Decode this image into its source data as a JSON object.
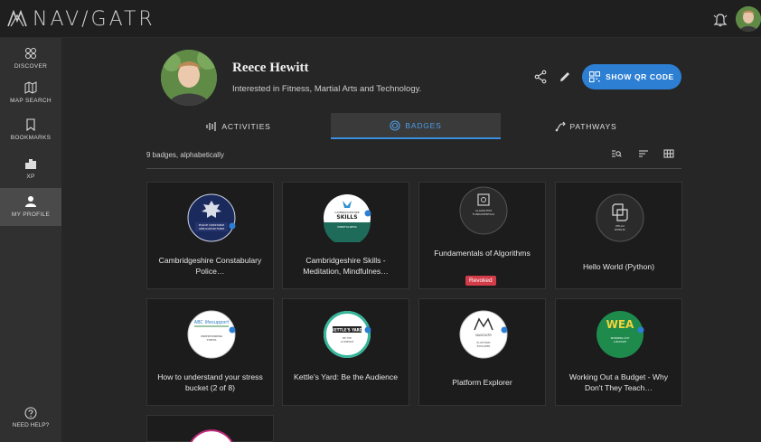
{
  "app": {
    "logo_text": "NAV/GATR"
  },
  "sidebar": {
    "items": [
      {
        "label": "DISCOVER",
        "icon": "discover-icon"
      },
      {
        "label": "MAP SEARCH",
        "icon": "map-icon"
      },
      {
        "label": "BOOKMARKS",
        "icon": "bookmark-icon"
      },
      {
        "label": "XP",
        "icon": "xp-icon"
      },
      {
        "label": "MY PROFILE",
        "icon": "person-icon",
        "active": true
      }
    ],
    "help_label": "NEED HELP?"
  },
  "profile": {
    "name": "Reece Hewitt",
    "bio": "Interested in Fitness, Martial Arts and Technology.",
    "qr_button_label": "SHOW QR CODE"
  },
  "tabs": [
    {
      "label": "ACTIVITIES",
      "icon": "activity-icon"
    },
    {
      "label": "BADGES",
      "icon": "badge-icon",
      "active": true
    },
    {
      "label": "PATHWAYS",
      "icon": "pathway-icon"
    }
  ],
  "list": {
    "count_text": "9 badges, alphabetically"
  },
  "badges": [
    {
      "title": "Cambridgeshire Constabulary Police…",
      "art_text": "POLICE CONSTABLE APPLICATION FORM"
    },
    {
      "title": "Cambridgeshire Skills - Meditation, Mindfulnes…",
      "art_text": "CAMBRIDGESHIRE SKILLS",
      "art_sub": "MINDFULNESS"
    },
    {
      "title": "Fundamentals of Algorithms",
      "status": "Revoked",
      "art_text": "ALGORITHM FUNDAMENTALS"
    },
    {
      "title": "Hello World (Python)",
      "art_text": "HELLO WORLD!"
    },
    {
      "title": "How to understand your stress bucket (2 of 8)",
      "art_text": "ABC lifesupport",
      "art_sub": "UNDERSTANDING STRESS"
    },
    {
      "title": "Kettle's Yard: Be the Audience",
      "art_text": "KETTLE'S YARD",
      "art_sub": "BE THE AUDIENCE"
    },
    {
      "title": "Platform Explorer",
      "art_text": "NAVIGATR",
      "art_sub": "PLATFORM EXPLORER"
    },
    {
      "title": "Working Out a Budget - Why Don't They Teach…",
      "art_text": "WEA",
      "art_sub": "WORKING OUT A BUDGET"
    },
    {
      "title": "",
      "art_text": ""
    }
  ],
  "colors": {
    "accent": "#2d7fd4",
    "revoked": "#d33d49",
    "wea_green": "#1e8a4c"
  }
}
